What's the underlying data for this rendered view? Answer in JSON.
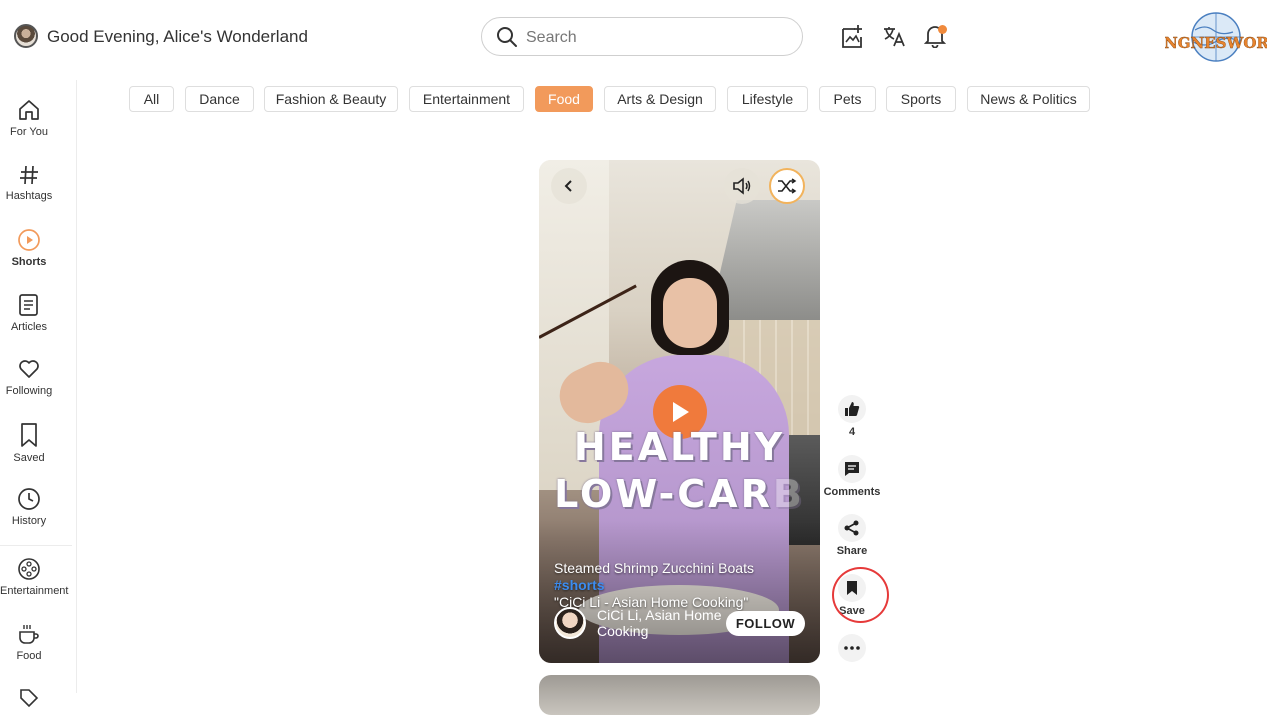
{
  "header": {
    "greeting": "Good Evening, Alice's Wonderland",
    "search_placeholder": "Search",
    "logo_text": "GANGNESWORLD"
  },
  "icons": {
    "create": "create-post-icon",
    "translate": "translate-icon",
    "notifications": "bell-icon"
  },
  "colors": {
    "accent": "#f29a5b",
    "play": "#f07a3c",
    "hashtag": "#3b8cf0",
    "save_highlight": "#e63a3a"
  },
  "sidebar": {
    "items": [
      {
        "label": "For You"
      },
      {
        "label": "Hashtags"
      },
      {
        "label": "Shorts"
      },
      {
        "label": "Articles"
      },
      {
        "label": "Following"
      },
      {
        "label": "Saved"
      },
      {
        "label": "History"
      },
      {
        "label": "Entertainment"
      },
      {
        "label": "Food"
      }
    ]
  },
  "categories": [
    {
      "label": "All"
    },
    {
      "label": "Dance"
    },
    {
      "label": "Fashion & Beauty"
    },
    {
      "label": "Entertainment"
    },
    {
      "label": "Food",
      "active": true
    },
    {
      "label": "Arts & Design"
    },
    {
      "label": "Lifestyle"
    },
    {
      "label": "Pets"
    },
    {
      "label": "Sports"
    },
    {
      "label": "News & Politics"
    }
  ],
  "video": {
    "overlay_line1": "HEALTHY",
    "overlay_line2": "LOW-CAR",
    "overlay_line2_faded": "B",
    "caption": "Steamed Shrimp Zucchini Boats",
    "hashtag": "#shorts",
    "caption_line2": "\"CiCi Li - Asian Home Cooking\"",
    "author": "CiCi Li, Asian Home Cooking",
    "follow_label": "FOLLOW"
  },
  "actions": {
    "likes_count": "4",
    "comments_label": "Comments",
    "share_label": "Share",
    "save_label": "Save"
  }
}
